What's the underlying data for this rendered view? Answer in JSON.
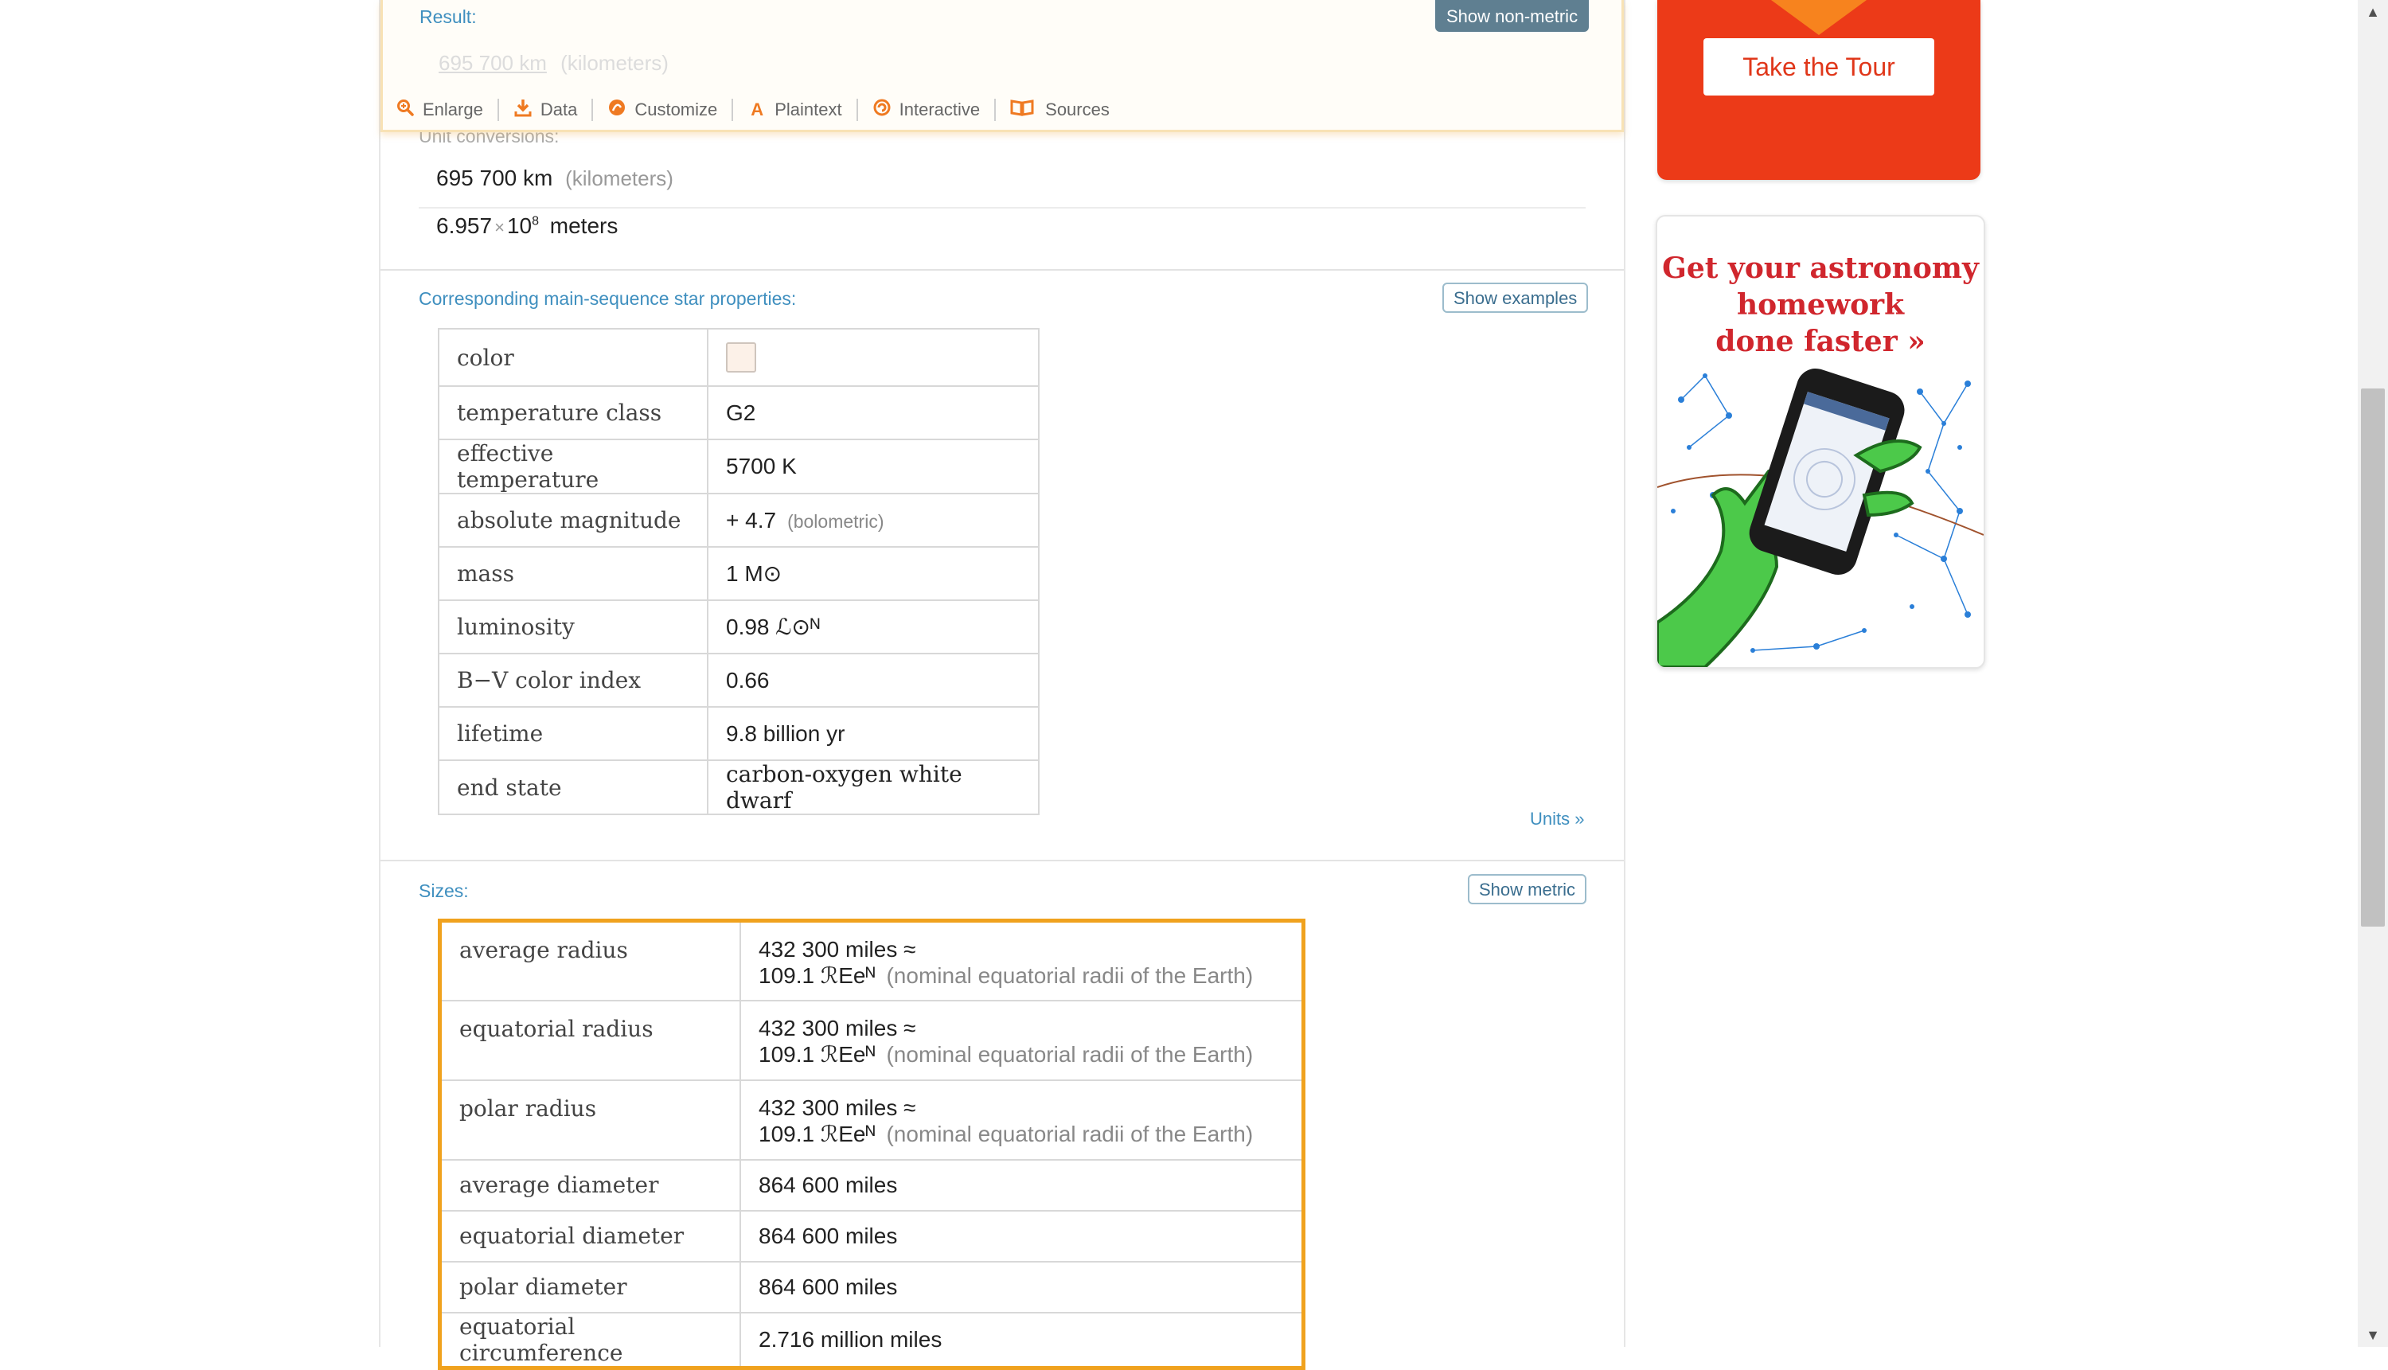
{
  "result": {
    "label": "Result:",
    "button": "Show non-metric",
    "faded_value": "695 700 km",
    "faded_suffix": "(kilometers)"
  },
  "toolbar": {
    "enlarge": "Enlarge",
    "data": "Data",
    "customize": "Customize",
    "plaintext": "Plaintext",
    "interactive": "Interactive",
    "sources": "Sources"
  },
  "conversions": {
    "label": "Unit conversions:",
    "row1_value": "695 700 km",
    "row1_note": "(kilometers)",
    "row2_mantissa": "6.957",
    "row2_times": "×",
    "row2_base": "10",
    "row2_exp": "8",
    "row2_unit": "meters"
  },
  "star_props": {
    "label": "Corresponding main-sequence star properties:",
    "button": "Show examples",
    "units_link": "Units »",
    "rows": [
      {
        "key": "color",
        "value": ""
      },
      {
        "key": "temperature class",
        "value": "G2"
      },
      {
        "key": "effective temperature",
        "value": "5700 K"
      },
      {
        "key": "absolute magnitude",
        "value": "+ 4.7",
        "note": "(bolometric)"
      },
      {
        "key": "mass",
        "value": "1 M⊙"
      },
      {
        "key": "luminosity",
        "value": "0.98 ℒ⊙ᴺ"
      },
      {
        "key": "B−V color index",
        "value": "0.66"
      },
      {
        "key": "lifetime",
        "value": "9.8 billion yr"
      },
      {
        "key": "end state",
        "value": "carbon-oxygen white dwarf"
      }
    ],
    "swatch_color": "#fcf1e8"
  },
  "sizes": {
    "label": "Sizes:",
    "button": "Show metric",
    "rows": [
      {
        "key": "average radius",
        "line1": "432 300 miles ≈",
        "line2": "109.1 ℛEeᴺ",
        "note": "(nominal equatorial radii of the Earth)"
      },
      {
        "key": "equatorial radius",
        "line1": "432 300 miles ≈",
        "line2": "109.1 ℛEeᴺ",
        "note": "(nominal equatorial radii of the Earth)"
      },
      {
        "key": "polar radius",
        "line1": "432 300 miles ≈",
        "line2": "109.1 ℛEeᴺ",
        "note": "(nominal equatorial radii of the Earth)"
      },
      {
        "key": "average diameter",
        "line1": "864 600 miles"
      },
      {
        "key": "equatorial diameter",
        "line1": "864 600 miles"
      },
      {
        "key": "polar diameter",
        "line1": "864 600 miles"
      },
      {
        "key": "equatorial circumference",
        "line1": "2.716 million miles"
      }
    ]
  },
  "sidebar": {
    "tour_button": "Take the Tour",
    "ad_headline_1": "Get your astronomy",
    "ad_headline_2": "homework",
    "ad_headline_3": "done faster »"
  },
  "colors": {
    "accent_orange": "#ef7a22",
    "link_blue": "#3f8fbf",
    "sizes_border": "#f0a21e",
    "tour_red": "#ec3a18"
  }
}
